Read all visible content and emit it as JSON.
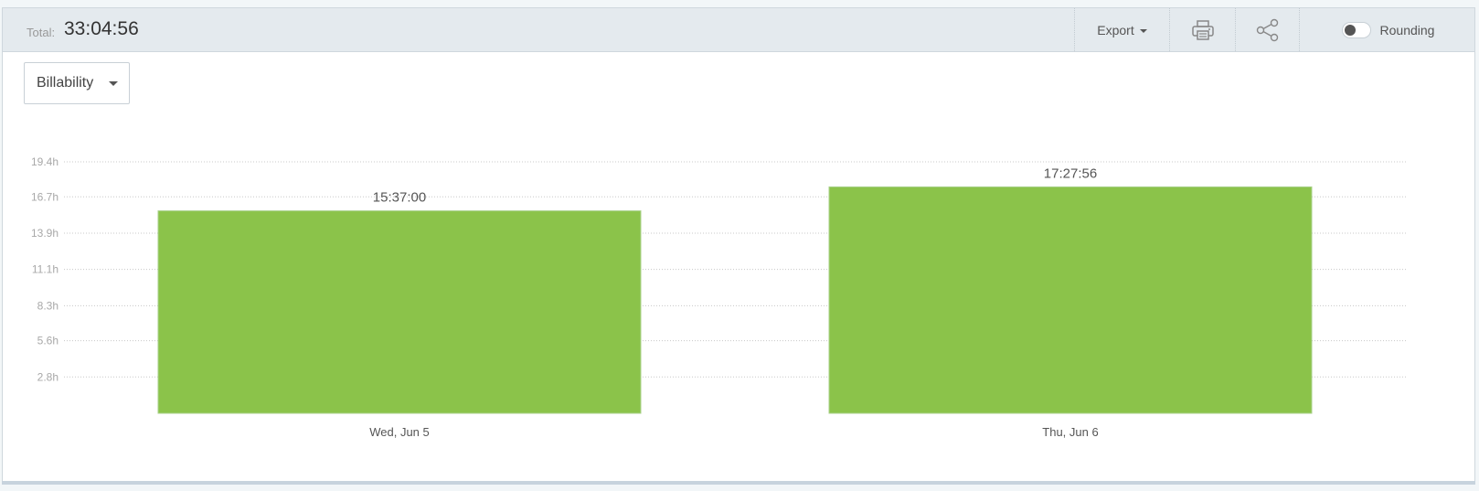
{
  "header": {
    "total_label": "Total:",
    "total_value": "33:04:56",
    "export_label": "Export",
    "print_icon": "printer-icon",
    "share_icon": "share-icon",
    "rounding_label": "Rounding",
    "rounding_enabled": false
  },
  "filter": {
    "selected": "Billability"
  },
  "colors": {
    "bar": "#8bc34a",
    "bar_border": "#a8d08a",
    "grid": "#c8c8c8"
  },
  "chart_data": {
    "type": "bar",
    "categories": [
      "Wed, Jun 5",
      "Thu, Jun 6"
    ],
    "values": [
      15.617,
      17.466
    ],
    "data_labels": [
      "15:37:00",
      "17:27:56"
    ],
    "yticks": [
      2.8,
      5.6,
      8.3,
      11.1,
      13.9,
      16.7,
      19.4
    ],
    "ytick_labels": [
      "2.8h",
      "5.6h",
      "8.3h",
      "11.1h",
      "13.9h",
      "16.7h",
      "19.4h"
    ],
    "ylim": [
      0,
      19.4
    ],
    "grid": true,
    "xlabel": "",
    "ylabel": ""
  }
}
